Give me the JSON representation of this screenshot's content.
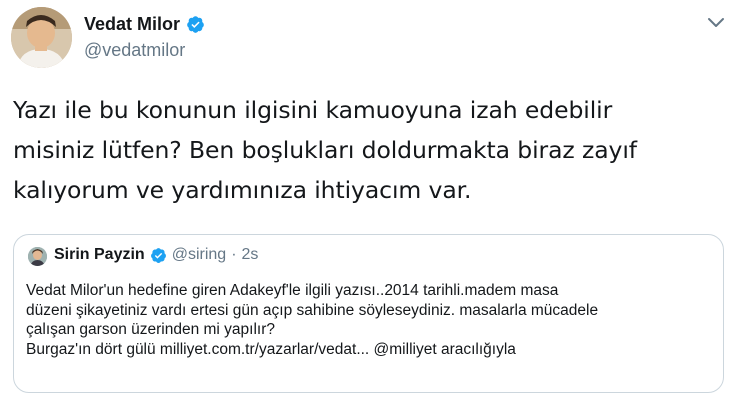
{
  "tweet": {
    "author_name": "Vedat Milor",
    "author_handle": "@vedatmilor",
    "text_lines": [
      "Yazı ile bu konunun ilgisini kamuoyuna izah edebilir",
      "misiniz lütfen? Ben boşlukları doldurmakta biraz zayıf",
      "kalıyorum ve yardımınıza ihtiyacım var."
    ]
  },
  "quoted_tweet": {
    "author_name": "Sirin Payzin",
    "author_handle": "@siring",
    "separator": "·",
    "time": "2s",
    "text_lines": [
      "Vedat Milor'un hedefine giren Adakeyf'le ilgili yazısı..2014 tarihli.madem masa",
      "düzeni şikayetiniz vardı ertesi gün açıp sahibine  söyleseydiniz. masalarla mücadele",
      "çalışan garson üzerinden mi  yapılır?",
      "Burgaz'ın dört gülü milliyet.com.tr/yazarlar/vedat... @milliyet aracılığıyla"
    ]
  },
  "colors": {
    "verified_blue": "#1da1f2",
    "secondary_text": "#657786",
    "border": "#ccd6dd"
  },
  "icons": {
    "verified": "verified-badge-icon",
    "menu": "chevron-down-icon"
  }
}
